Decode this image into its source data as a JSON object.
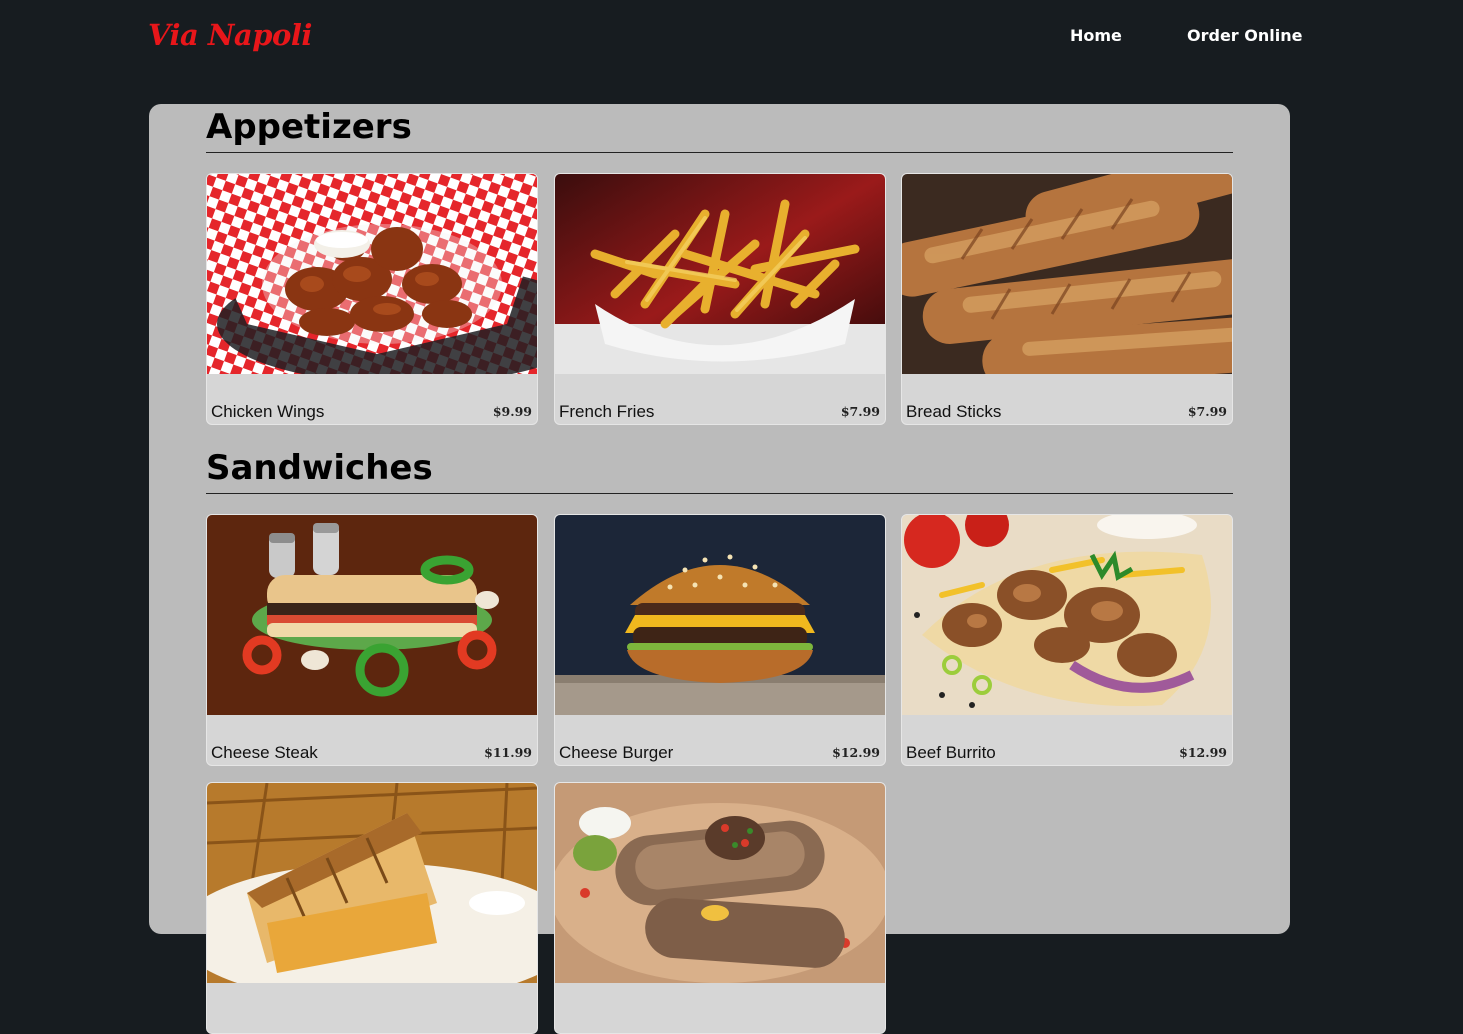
{
  "nav": {
    "brand": "Via Napoli",
    "links": [
      {
        "label": "Home"
      },
      {
        "label": "Order Online"
      }
    ]
  },
  "colors": {
    "background": "#171c20",
    "brand": "#e8161a",
    "panel": "#bbbbbb",
    "card": "#d6d6d6"
  },
  "menu": {
    "sections": [
      {
        "title": "Appetizers",
        "items": [
          {
            "name": "Chicken Wings",
            "price": "$9.99",
            "image": "chicken-wings-photo"
          },
          {
            "name": "French Fries",
            "price": "$7.99",
            "image": "french-fries-photo"
          },
          {
            "name": "Bread Sticks",
            "price": "$7.99",
            "image": "bread-sticks-photo"
          }
        ]
      },
      {
        "title": "Sandwiches",
        "items": [
          {
            "name": "Cheese Steak",
            "price": "$11.99",
            "image": "cheese-steak-photo"
          },
          {
            "name": "Cheese Burger",
            "price": "$12.99",
            "image": "cheese-burger-photo"
          },
          {
            "name": "Beef Burrito",
            "price": "$12.99",
            "image": "beef-burrito-photo"
          },
          {
            "image": "grilled-sandwich-photo"
          },
          {
            "image": "wrap-photo"
          }
        ]
      }
    ]
  }
}
